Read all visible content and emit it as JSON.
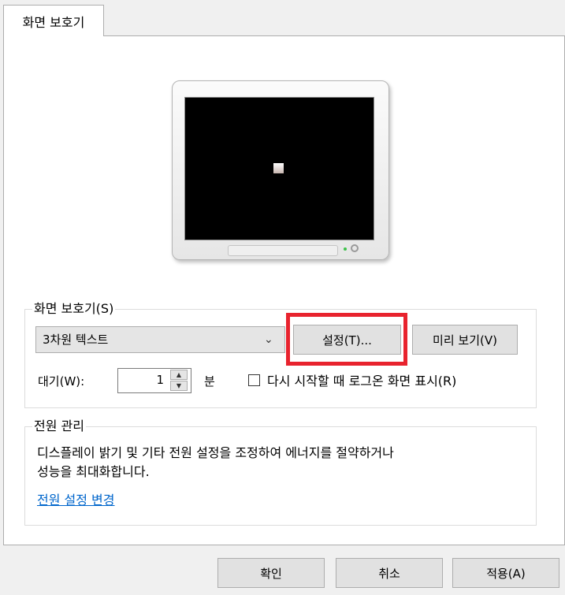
{
  "tab": {
    "label": "화면 보호기"
  },
  "screensaver_group": {
    "label": "화면 보호기(S)",
    "selected": "3차원 텍스트",
    "settings_button": "설정(T)...",
    "preview_button": "미리 보기(V)",
    "wait_label": "대기(W):",
    "wait_value": "1",
    "wait_unit": "분",
    "resume_checkbox_label": "다시 시작할 때 로그온 화면 표시(R)",
    "resume_checked": false
  },
  "power_group": {
    "label": "전원 관리",
    "description_line1": "디스플레이 밝기 및 기타 전원 설정을 조정하여 에너지를 절약하거나",
    "description_line2": "성능을 최대화합니다.",
    "link": "전원 설정 변경"
  },
  "footer": {
    "ok": "확인",
    "cancel": "취소",
    "apply": "적용(A)"
  },
  "colors": {
    "highlight": "#e8232e",
    "link": "#0066cc"
  },
  "icons": [
    "chevron-down-icon",
    "spin-up-icon",
    "spin-down-icon"
  ]
}
